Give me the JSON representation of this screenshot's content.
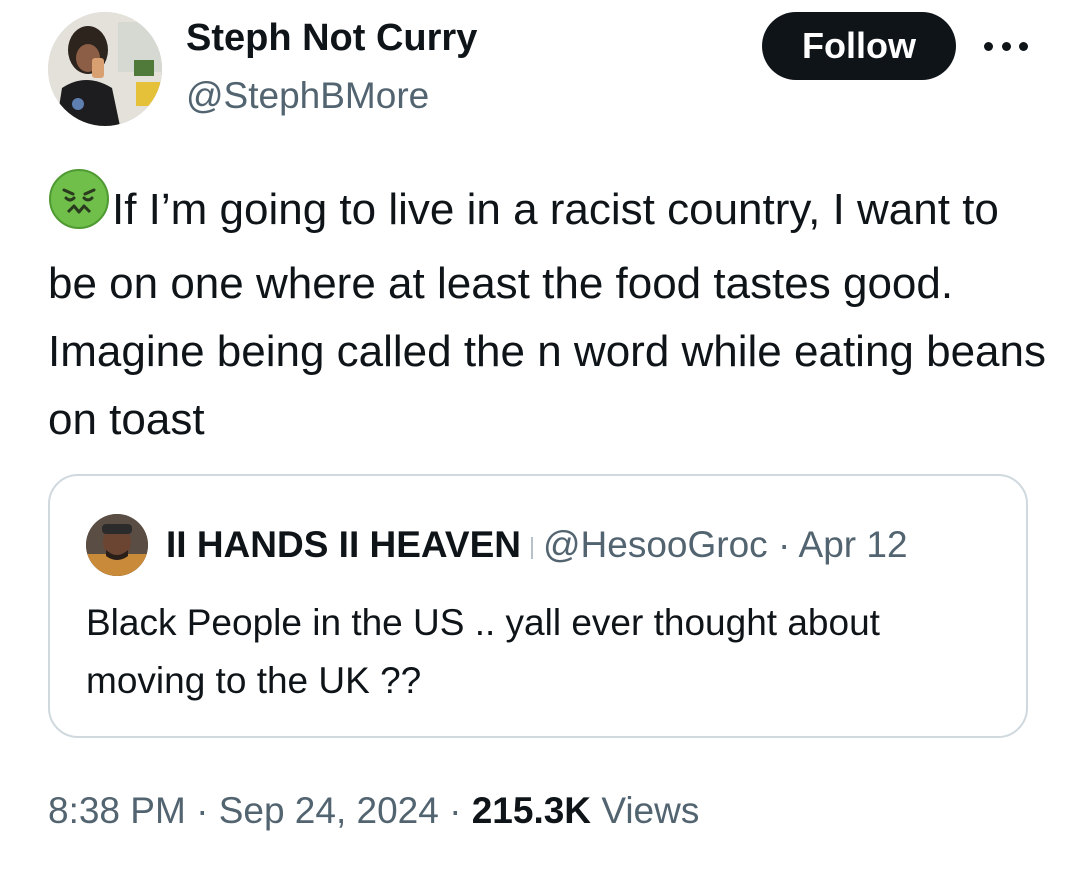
{
  "author": {
    "display_name": "Steph Not Curry",
    "handle": "@StephBMore",
    "avatar_icon": "profile-photo"
  },
  "actions": {
    "follow_label": "Follow",
    "more_icon": "more-horizontal-icon"
  },
  "tweet": {
    "emoji": "nauseated-face",
    "text": "If I’m going to live in a racist country, I want to be on one where at least the food tastes good. Imagine being called the n word while eating beans on toast"
  },
  "quote": {
    "display_name": "II HANDS II HEAVEN",
    "handle": "@HesooGroc",
    "separator": "·",
    "date": "Apr 12",
    "text": "Black People in the US .. yall ever thought about moving to the UK ??"
  },
  "meta": {
    "time": "8:38 PM",
    "separator": "·",
    "date": "Sep 24, 2024",
    "views_count": "215.3K",
    "views_label": "Views"
  },
  "colors": {
    "text_primary": "#0f1419",
    "text_secondary": "#536471",
    "border": "#cfd9de",
    "emoji_green": "#6fbf4a"
  }
}
